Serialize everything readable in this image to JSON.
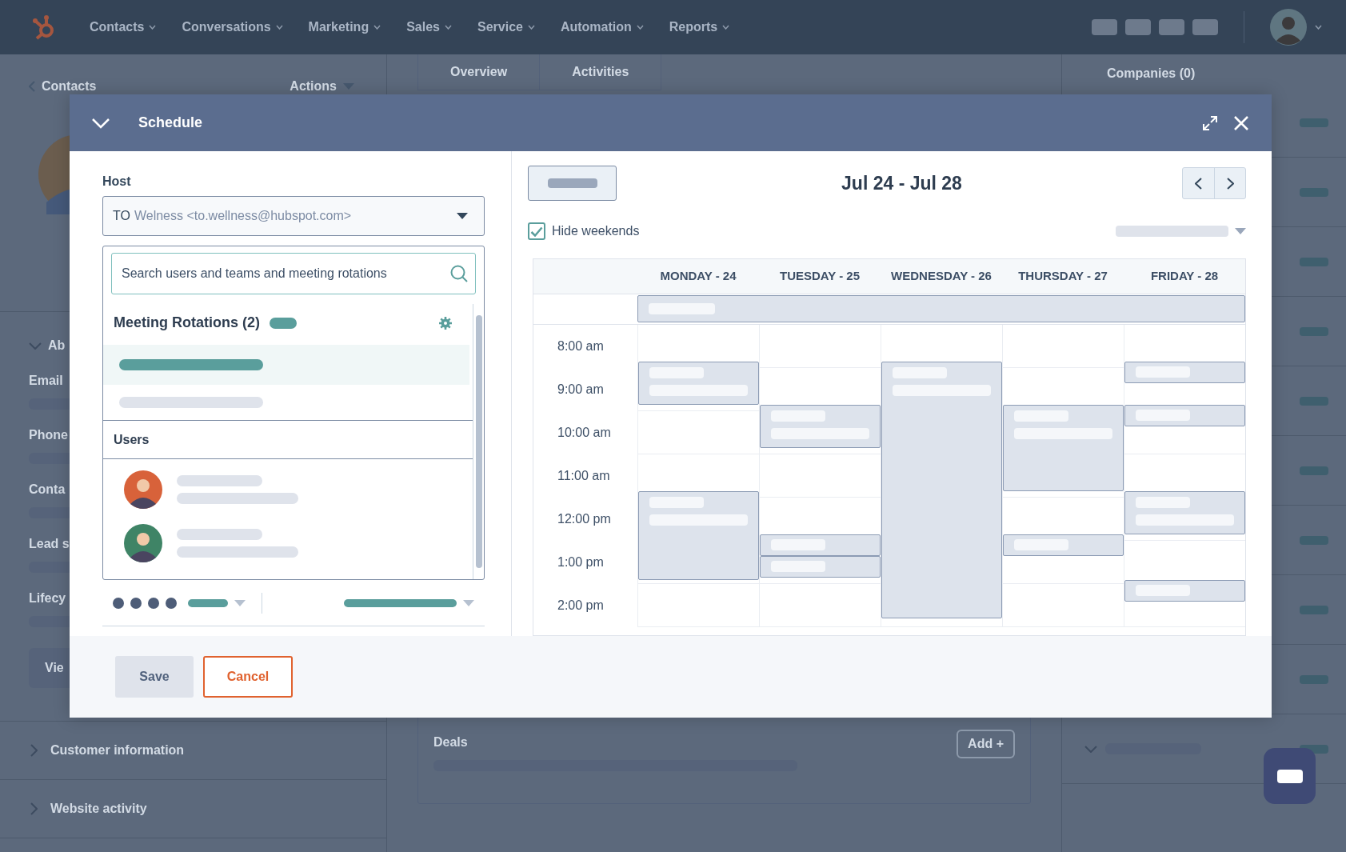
{
  "top_nav": {
    "items": [
      {
        "label": "Contacts"
      },
      {
        "label": "Conversations"
      },
      {
        "label": "Marketing"
      },
      {
        "label": "Sales"
      },
      {
        "label": "Service"
      },
      {
        "label": "Automation"
      },
      {
        "label": "Reports"
      }
    ]
  },
  "record_panel": {
    "back_link": "Contacts",
    "actions": "Actions",
    "section": "Ab",
    "field_labels": [
      "Email",
      "Phone",
      "Conta",
      "Lead s",
      "Lifecy"
    ],
    "view_button": "Vie",
    "collapsed_sections": [
      "Customer information",
      "Website activity"
    ]
  },
  "center_panel": {
    "tabs": [
      {
        "label": "Overview",
        "selected": true
      },
      {
        "label": "Activities",
        "selected": false
      }
    ],
    "deals": {
      "title": "Deals",
      "add_button": "Add +"
    }
  },
  "right_panel": {
    "title": "Companies (0)"
  },
  "modal": {
    "title": "Schedule",
    "host": {
      "label": "Host",
      "initials": "TO",
      "name": "Welness <to.wellness@hubspot.com>"
    },
    "search": {
      "placeholder": "Search users and teams and meeting rotations"
    },
    "rotations_title": "Meeting Rotations (2)",
    "rotations": [
      {
        "selected": true
      },
      {
        "selected": false
      }
    ],
    "users_title": "Users",
    "calendar": {
      "range": "Jul 24 - Jul 28",
      "hide_weekends": {
        "label": "Hide weekends",
        "checked": true
      },
      "days": [
        "MONDAY - 24",
        "TUESDAY - 25",
        "WEDNESDAY - 26",
        "THURSDAY - 27",
        "FRIDAY - 28"
      ],
      "times": [
        "8:00 am",
        "9:00 am",
        "10:00 am",
        "11:00 am",
        "12:00 pm",
        "1:00 pm",
        "2:00 pm"
      ]
    },
    "buttons": [
      {
        "label": "Save",
        "kind": "secondary"
      },
      {
        "label": "Cancel",
        "kind": "outline"
      }
    ]
  }
}
